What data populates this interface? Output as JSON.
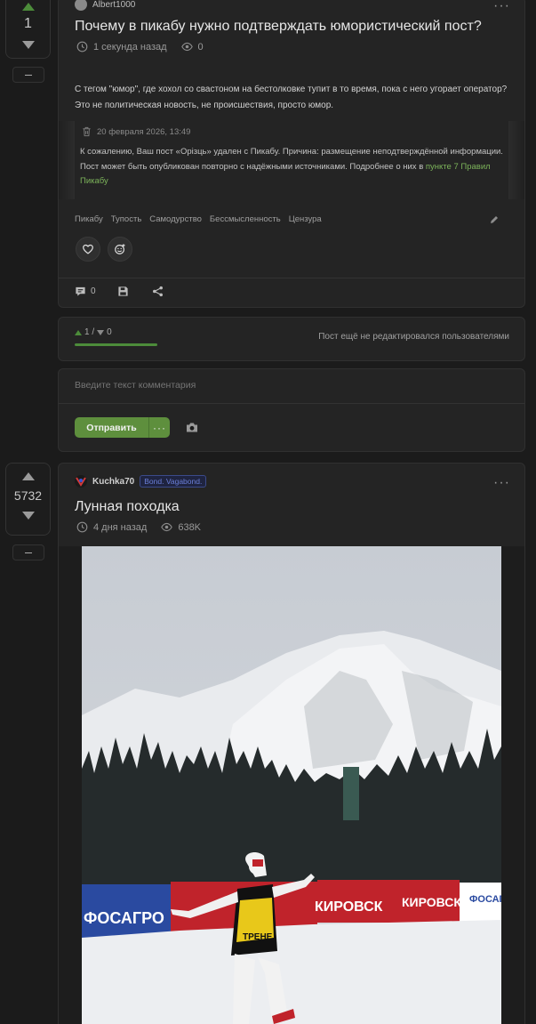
{
  "post1": {
    "votes": "1",
    "author": "Albert1000",
    "title": "Почему в пикабу нужно подтверждать юмористический пост?",
    "time": "1 секунда назад",
    "views": "0",
    "body": "С тегом \"юмор\", где хохол со свастоном на бестолковке тупит в то время, пока с него угорает оператор? Это не политическая новость, не происшествия, просто юмор.",
    "notice": {
      "date": "20 февраля 2026, 13:49",
      "text": "К сожалению, Ваш пост «Орізць» удален с Пикабу. Причина: размещение неподтверждённой информации. Пост может быть опубликован повторно с надёжными источниками. Подробнее о них в ",
      "link": "пункте 7 Правил Пикабу"
    },
    "tags": [
      "Пикабу",
      "Тупость",
      "Самодурство",
      "Бессмысленность",
      "Цензура"
    ],
    "comments_count": "0",
    "rating_summary": "1 / ",
    "rating_minus": "0",
    "rating_fraction": 1.0,
    "edit_status": "Пост ещё не редактировался пользователями",
    "comment_placeholder": "Введите текст комментария",
    "send_label": "Отправить"
  },
  "post2": {
    "votes": "5732",
    "author": "Kuchka70",
    "badge": "Bond. Vagabond.",
    "title": "Лунная походка",
    "time": "4 дня назад",
    "views": "638K"
  },
  "image_text": {
    "brand_left": "ФОСАГРО",
    "brand_mid1": "КИРОВСК",
    "brand_mid2": "КИРОВСК",
    "brand_right": "ФОСАГ",
    "bib": "ТРЕНЕ"
  },
  "colors": {
    "accent_green": "#5e8f3d",
    "background": "#1b1b1b",
    "card": "#242424",
    "badge_blue": "#6b7fd8"
  }
}
